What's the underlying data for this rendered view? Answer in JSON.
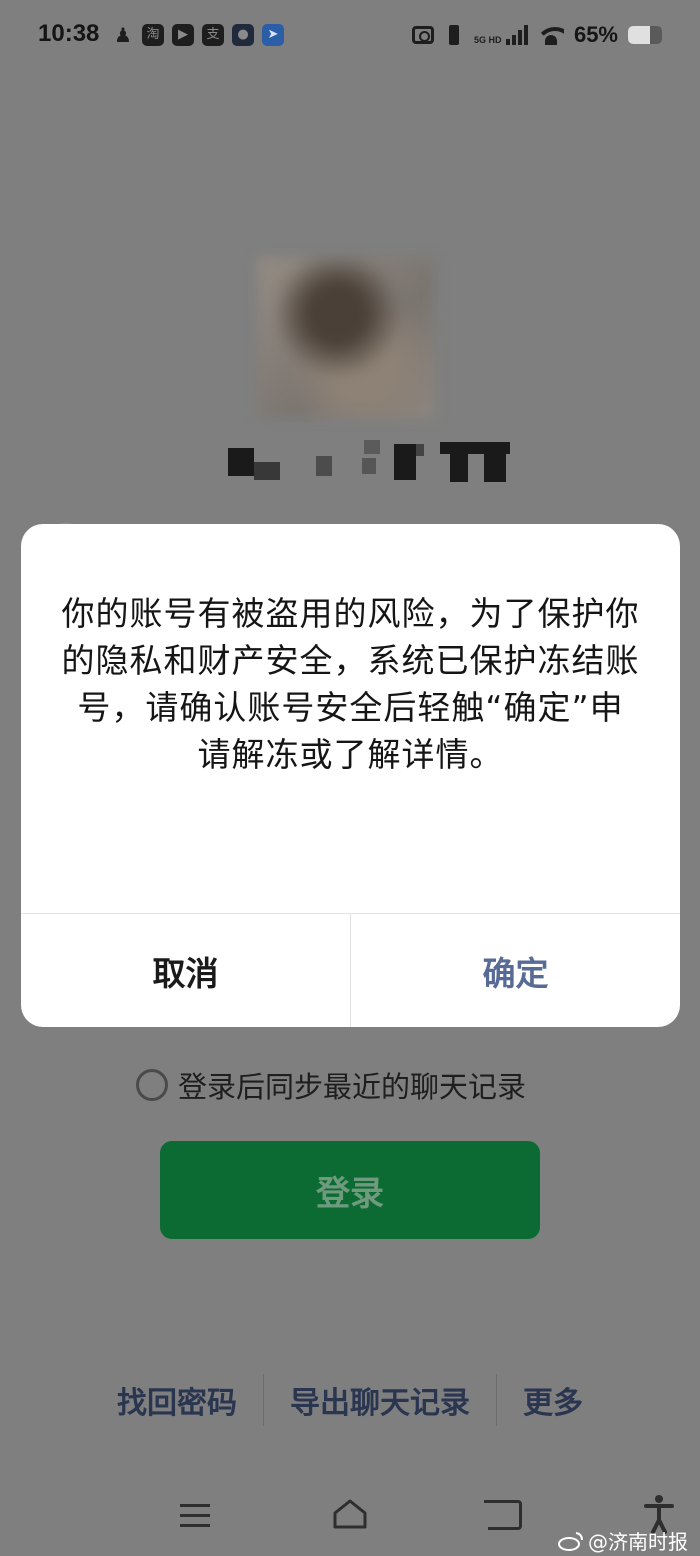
{
  "status_bar": {
    "time": "10:38",
    "notification_icons": [
      "qq-icon",
      "taobao-icon",
      "video-icon",
      "alipay-icon",
      "app-icon",
      "ding-icon"
    ],
    "taobao_glyph": "淘",
    "alipay_glyph": "支",
    "network_label": "5G HD",
    "battery_percent": "65%",
    "battery_level": 0.65
  },
  "profile": {
    "avatar": "blurred-avatar",
    "username_obscured": true
  },
  "dialog": {
    "message": "你的账号有被盗用的风险，为了保护你的隐私和财产安全，系统已保护冻结账号，请确认账号安全后轻触“确定”申请解冻或了解详情。",
    "cancel_label": "取消",
    "confirm_label": "确定",
    "confirm_color": "#576b95"
  },
  "sync_option": {
    "label": "登录后同步最近的聊天记录",
    "checked": false
  },
  "login": {
    "button_label": "登录",
    "button_color": "#0b6b33"
  },
  "bottom_links": {
    "recover_password": "找回密码",
    "export_chat": "导出聊天记录",
    "more": "更多"
  },
  "nav_bar": {
    "icons": [
      "menu-icon",
      "home-icon",
      "back-icon",
      "accessibility-icon"
    ]
  },
  "watermark": {
    "text": "@济南时报"
  }
}
